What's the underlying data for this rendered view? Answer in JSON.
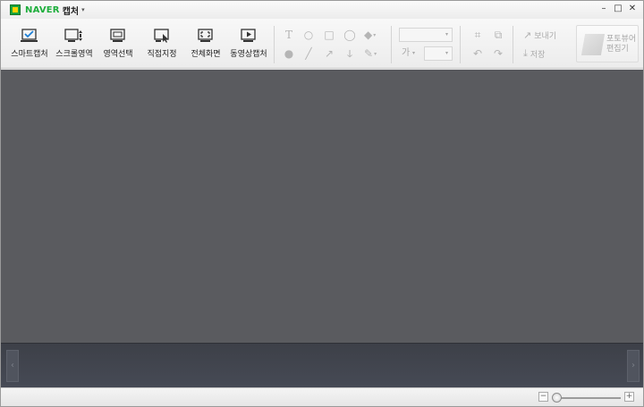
{
  "window": {
    "brand": "NAVER",
    "app_name": "캡처",
    "menu_arrow": "▾",
    "minimize": "–",
    "maximize": "□",
    "close": "✕"
  },
  "capture_modes": [
    {
      "label": "스마트캡처",
      "icon": "smart-capture-icon"
    },
    {
      "label": "스크롤영역",
      "icon": "scroll-area-icon"
    },
    {
      "label": "영역선택",
      "icon": "area-select-icon"
    },
    {
      "label": "직접지정",
      "icon": "manual-select-icon"
    },
    {
      "label": "전체화면",
      "icon": "fullscreen-icon"
    },
    {
      "label": "동영상캡처",
      "icon": "video-capture-icon"
    }
  ],
  "draw_tools": {
    "text": "T",
    "ellipse": "○",
    "rect": "□",
    "balloon": "◯",
    "fill": "◆",
    "number": "●",
    "line": "╱",
    "arrow": "↗",
    "freehand": "ↆ",
    "pen": "✎",
    "combo_arrow": "▾"
  },
  "font_dropdown": {
    "value": ""
  },
  "size_dropdown": {
    "value": ""
  },
  "font_icon": "가",
  "edit_tools": {
    "crop": "⌗",
    "resize": "⧉",
    "undo": "↶",
    "redo": "↷"
  },
  "actions": {
    "send_label": "보내기",
    "save_label": "저장",
    "send_icon": "↗",
    "save_icon": "⤓"
  },
  "photo_editor": {
    "line1": "포토뷰어",
    "line2": "편집기"
  },
  "strip": {
    "prev": "‹",
    "next": "›"
  },
  "zoom": {
    "minus": "−",
    "plus": "+",
    "level": 0.05
  },
  "colors": {
    "canvas": "#5a5b5f",
    "brand": "#1eae3c"
  }
}
